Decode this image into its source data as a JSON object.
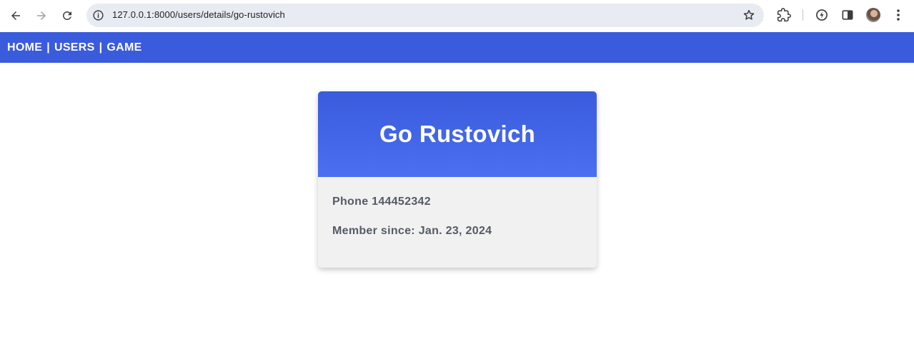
{
  "browser": {
    "url": "127.0.0.1:8000/users/details/go-rustovich",
    "icons": [
      "back-icon",
      "forward-icon",
      "reload-icon",
      "site-info-icon",
      "bookmark-star-icon",
      "extensions-icon",
      "performance-icon",
      "side-panel-icon",
      "profile-avatar",
      "menu-icon"
    ]
  },
  "nav": {
    "links": [
      {
        "label": "HOME"
      },
      {
        "label": "USERS"
      },
      {
        "label": "GAME"
      }
    ],
    "separator": "|"
  },
  "user": {
    "name": "Go Rustovich",
    "phone_label": "Phone",
    "phone": "144452342",
    "member_since_label": "Member since:",
    "member_since": "Jan. 23, 2024"
  },
  "colors": {
    "nav_bg": "#3a5bdc",
    "card_header_top": "#3a5bdc",
    "card_header_bottom": "#4a6ff0",
    "card_body_bg": "#f1f1f1",
    "card_text": "#555a66"
  }
}
